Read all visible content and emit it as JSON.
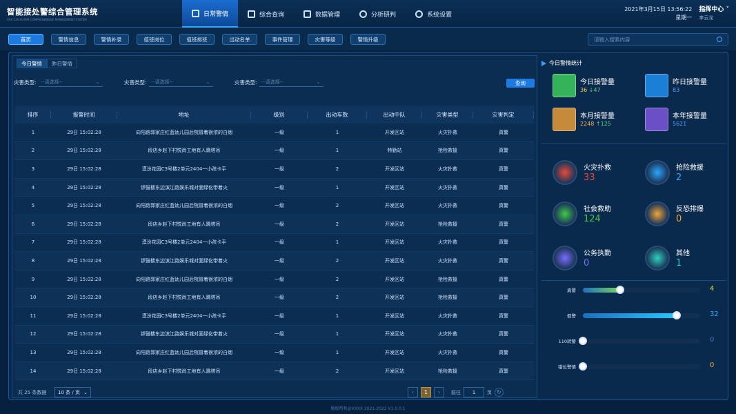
{
  "header": {
    "title": "智能接处警综合管理系统",
    "subtitle": "XXX 119 ALARM COMPREHENSIVE MANAGEMENT SYSTEM",
    "date": "2021年3月15日",
    "time": "13:56:22",
    "weekday": "星期一",
    "user": "指挥中心",
    "user_name": "李云龙",
    "nav": [
      {
        "label": "日常警情",
        "icon": "siren-icon"
      },
      {
        "label": "综合查询",
        "icon": "search-doc-icon"
      },
      {
        "label": "数据管理",
        "icon": "bar-chart-icon"
      },
      {
        "label": "分析研判",
        "icon": "pie-chart-icon"
      },
      {
        "label": "系统设置",
        "icon": "gear-icon"
      }
    ]
  },
  "tabs": [
    "首页",
    "警情信息",
    "警情补录",
    "值班岗位",
    "值班排班",
    "出动名单",
    "事件管理",
    "灾害等级",
    "警情升级"
  ],
  "search": {
    "placeholder": "请输入搜索内容"
  },
  "inner_tabs": [
    "今日警情",
    "昨日警情"
  ],
  "filters": [
    {
      "label": "灾害类型:",
      "placeholder": "--请选择--"
    },
    {
      "label": "灾害类型:",
      "placeholder": "--请选择--"
    },
    {
      "label": "灾害类型:",
      "placeholder": "--请选择--"
    }
  ],
  "query_label": "查询",
  "columns": [
    "排序",
    "报警时间",
    "地址",
    "级别",
    "出动车数",
    "出动中队",
    "灾害类型",
    "灾害判定"
  ],
  "rows": [
    [
      "1",
      "29日 15:02:28",
      "向阳路郭家庄红蓝幼儿园后院冒着很浓的白烟",
      "一级",
      "1",
      "开发区站",
      "火灾扑救",
      "真警"
    ],
    [
      "2",
      "29日 15:02:28",
      "段店乡赵下村悦尚工地有人跳塔吊",
      "一级",
      "1",
      "特勤站",
      "抢险救援",
      "真警"
    ],
    [
      "3",
      "29日 15:02:28",
      "漠汾花园C3号楼2单元2404一小孩卡手",
      "一级",
      "2",
      "开发区站",
      "火灾扑救",
      "真警"
    ],
    [
      "4",
      "29日 15:02:28",
      "锣鼓楼东边滨江路娱乐城对面绿化带着火",
      "一级",
      "1",
      "开发区站",
      "火灾扑救",
      "真警"
    ],
    [
      "5",
      "29日 15:02:28",
      "向阳路郭家庄红蓝幼儿园后院冒着很浓的白烟",
      "一级",
      "2",
      "开发区站",
      "火灾扑救",
      "真警"
    ],
    [
      "6",
      "29日 15:02:28",
      "段店乡赵下村悦尚工地有人跳塔吊",
      "一级",
      "2",
      "开发区站",
      "抢险救援",
      "真警"
    ],
    [
      "7",
      "29日 15:02:28",
      "漠汾花园C3号楼2单元2404一小孩卡手",
      "一级",
      "1",
      "开发区站",
      "火灾扑救",
      "真警"
    ],
    [
      "8",
      "29日 15:02:28",
      "锣鼓楼东边滨江路娱乐城对面绿化带着火",
      "一级",
      "2",
      "开发区站",
      "火灾扑救",
      "真警"
    ],
    [
      "9",
      "29日 15:02:28",
      "向阳路郭家庄红蓝幼儿园后院冒着很浓的白烟",
      "一级",
      "2",
      "开发区站",
      "抢险救援",
      "真警"
    ],
    [
      "10",
      "29日 15:02:28",
      "段店乡赵下村悦尚工地有人跳塔吊",
      "一级",
      "2",
      "开发区站",
      "抢险救援",
      "真警"
    ],
    [
      "11",
      "29日 15:02:28",
      "漠汾花园C3号楼2单元2404一小孩卡手",
      "一级",
      "1",
      "开发区站",
      "火灾扑救",
      "真警"
    ],
    [
      "12",
      "29日 15:02:28",
      "锣鼓楼东边滨江路娱乐城对面绿化带着火",
      "一级",
      "1",
      "开发区站",
      "火灾扑救",
      "真警"
    ],
    [
      "13",
      "29日 15:02:28",
      "向阳路郭家庄红蓝幼儿园后院冒着很浓的白烟",
      "一级",
      "1",
      "开发区站",
      "火灾扑救",
      "真警"
    ],
    [
      "14",
      "29日 15:02:28",
      "段店乡赵下村悦尚工地有人跳塔吊",
      "一级",
      "2",
      "开发区站",
      "抢险救援",
      "真警"
    ]
  ],
  "pagination": {
    "total": "共 25 条数据",
    "page_size": "10 条 / 页",
    "current": "1",
    "goto": "前往",
    "goto_value": "1",
    "page_suffix": "页"
  },
  "stats": {
    "title": "今日警情统计",
    "boxes": [
      {
        "label": "今日接警量",
        "value": "36",
        "delta": "↓47",
        "color": "#35b35a"
      },
      {
        "label": "昨日接警量",
        "value": "83",
        "delta": "",
        "color": "#1b7fd6"
      },
      {
        "label": "本月接警量",
        "value": "2248",
        "delta": "↑125",
        "color": "#c58a3a"
      },
      {
        "label": "本年接警量",
        "value": "5621",
        "delta": "",
        "color": "#6a4fc7"
      }
    ],
    "types": [
      {
        "label": "火灾扑救",
        "value": "33",
        "color": "#e84a3a",
        "icon": "fire-icon"
      },
      {
        "label": "抢险救援",
        "value": "2",
        "color": "#2aa6ff",
        "icon": "rescue-truck-icon"
      },
      {
        "label": "社会救助",
        "value": "124",
        "color": "#3ec84a",
        "icon": "hand-heart-icon"
      },
      {
        "label": "反恐排爆",
        "value": "0",
        "color": "#f0a53a",
        "icon": "bomb-icon"
      },
      {
        "label": "公务执勤",
        "value": "0",
        "color": "#7a6cff",
        "icon": "officer-icon"
      },
      {
        "label": "其他",
        "value": "1",
        "color": "#2fd0c0",
        "icon": "layers-icon"
      }
    ],
    "bars": [
      {
        "label": "真警",
        "value": "4",
        "fraction": 0.32,
        "color": "#7ad25b"
      },
      {
        "label": "假警",
        "value": "32",
        "fraction": 0.8,
        "color": "#25c7ff"
      },
      {
        "label": "110转警",
        "value": "0",
        "fraction": 0,
        "color": "#3c6fb0"
      },
      {
        "label": "错位警情",
        "value": "0",
        "fraction": 0,
        "color": "#e8b13a"
      }
    ]
  },
  "copyright": "版权所有@XXXX  2021-2022 V1.0.0.1"
}
